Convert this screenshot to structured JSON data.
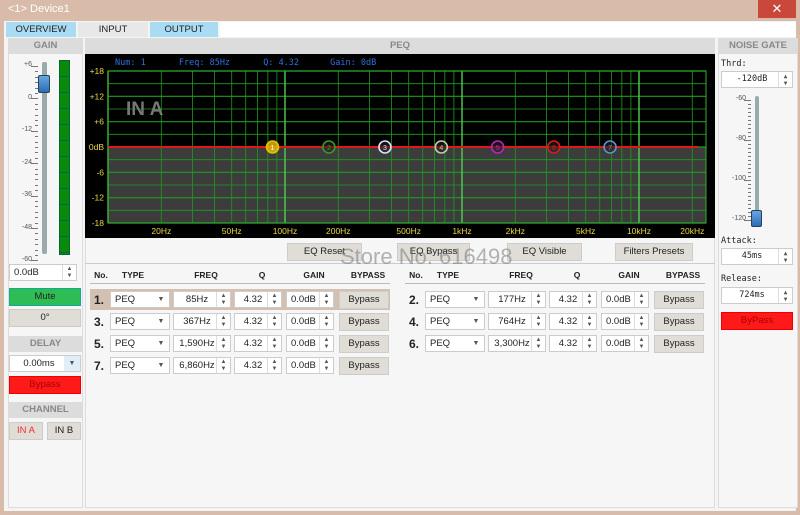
{
  "window": {
    "title": "<1> Device1",
    "close_icon": "close-x"
  },
  "tabs": [
    {
      "label": "OVERVIEW",
      "active": true
    },
    {
      "label": "INPUT",
      "active": false
    },
    {
      "label": "OUTPUT",
      "active": true
    }
  ],
  "gain": {
    "header": "GAIN",
    "scale": [
      "+6",
      "0",
      "-12",
      "-24",
      "-36",
      "-48",
      "-60"
    ],
    "value": "0.0dB",
    "level_db": 0,
    "mute": "Mute",
    "phase": "0°"
  },
  "delay": {
    "header": "DELAY",
    "value": "0.00ms",
    "bypass": "Bypass"
  },
  "channel": {
    "header": "CHANNEL",
    "in_a": "IN A",
    "in_b": "IN B"
  },
  "peq": {
    "header": "PEQ",
    "info": {
      "num_label": "Num:",
      "num": "1",
      "freq_label": "Freq:",
      "freq": "85Hz",
      "q_label": "Q:",
      "q": "4.32",
      "gain_label": "Gain:",
      "gain": "0dB"
    },
    "channel_label": "IN A",
    "y_ticks": [
      "+18",
      "+12",
      "+6",
      "0dB",
      "-6",
      "-12",
      "-18"
    ],
    "x_ticks": [
      "20Hz",
      "50Hz",
      "100Hz",
      "200Hz",
      "500Hz",
      "1kHz",
      "2kHz",
      "5kHz",
      "10kHz",
      "20kHz"
    ],
    "nodes": [
      {
        "n": "1",
        "freq": 85,
        "color": "#e8c000"
      },
      {
        "n": "2",
        "freq": 177,
        "color": "#3a9a20"
      },
      {
        "n": "3",
        "freq": 367,
        "color": "#e0e0ff"
      },
      {
        "n": "4",
        "freq": 764,
        "color": "#c8c8b0"
      },
      {
        "n": "5",
        "freq": 1590,
        "color": "#c020c0"
      },
      {
        "n": "6",
        "freq": 3300,
        "color": "#e01818"
      },
      {
        "n": "7",
        "freq": 6860,
        "color": "#6090d0"
      }
    ],
    "buttons": {
      "reset": "EQ Reset",
      "bypass": "EQ Bypass",
      "visible": "EQ Visible",
      "presets": "Filters Presets"
    },
    "columns": [
      "No.",
      "TYPE",
      "FREQ",
      "Q",
      "GAIN",
      "BYPASS"
    ],
    "left_rows": [
      {
        "no": "1.",
        "type": "PEQ",
        "freq": "85Hz",
        "q": "4.32",
        "gain": "0.0dB",
        "bypass": "Bypass"
      },
      {
        "no": "3.",
        "type": "PEQ",
        "freq": "367Hz",
        "q": "4.32",
        "gain": "0.0dB",
        "bypass": "Bypass"
      },
      {
        "no": "5.",
        "type": "PEQ",
        "freq": "1,590Hz",
        "q": "4.32",
        "gain": "0.0dB",
        "bypass": "Bypass"
      },
      {
        "no": "7.",
        "type": "PEQ",
        "freq": "6,860Hz",
        "q": "4.32",
        "gain": "0.0dB",
        "bypass": "Bypass"
      }
    ],
    "right_rows": [
      {
        "no": "2.",
        "type": "PEQ",
        "freq": "177Hz",
        "q": "4.32",
        "gain": "0.0dB",
        "bypass": "Bypass"
      },
      {
        "no": "4.",
        "type": "PEQ",
        "freq": "764Hz",
        "q": "4.32",
        "gain": "0.0dB",
        "bypass": "Bypass"
      },
      {
        "no": "6.",
        "type": "PEQ",
        "freq": "3,300Hz",
        "q": "4.32",
        "gain": "0.0dB",
        "bypass": "Bypass"
      }
    ]
  },
  "noise_gate": {
    "header": "NOISE GATE",
    "thrd_label": "Thrd:",
    "thrd": "-120dB",
    "scale": [
      "-60",
      "-80",
      "-100",
      "-120"
    ],
    "attack_label": "Attack:",
    "attack": "45ms",
    "release_label": "Release:",
    "release": "724ms",
    "bypass": "ByPass"
  },
  "watermark": "Store No: 616498"
}
